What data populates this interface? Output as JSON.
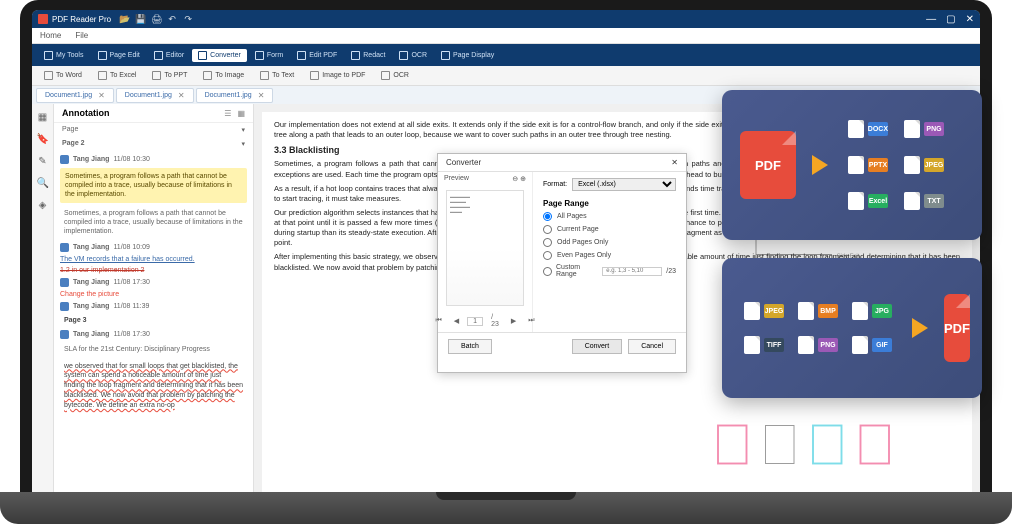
{
  "app": {
    "name": "PDF Reader Pro"
  },
  "menu": {
    "home": "Home",
    "file": "File"
  },
  "ribbon": [
    {
      "label": "My Tools"
    },
    {
      "label": "Page Edit"
    },
    {
      "label": "Editor"
    },
    {
      "label": "Converter",
      "active": true
    },
    {
      "label": "Form"
    },
    {
      "label": "Edit PDF"
    },
    {
      "label": "Redact"
    },
    {
      "label": "OCR"
    },
    {
      "label": "Page Display"
    }
  ],
  "subribbon": [
    {
      "label": "To Word"
    },
    {
      "label": "To Excel"
    },
    {
      "label": "To PPT"
    },
    {
      "label": "To Image"
    },
    {
      "label": "To Text"
    },
    {
      "label": "Image to PDF"
    },
    {
      "label": "OCR"
    }
  ],
  "tabs": [
    {
      "name": "Document1.jpg"
    },
    {
      "name": "Document1.jpg"
    },
    {
      "name": "Document1.jpg"
    }
  ],
  "annotation": {
    "title": "Annotation",
    "filter": "Page",
    "page_label": "Page 2",
    "items": [
      {
        "author": "Tang Jiang",
        "time": "11/08 10:30",
        "type": "highlight",
        "text": "Sometimes, a program follows a path that cannot be compiled into a trace, usually because of limitations in the implementation."
      },
      {
        "type": "note",
        "text": "Sometimes, a program follows a path that cannot be compiled into a trace, usually because of limitations in the implementation."
      },
      {
        "author": "Tang Jiang",
        "time": "11/08 10:09",
        "type": "link",
        "text": "The VM records that a failure has occurred."
      },
      {
        "type": "strike",
        "text": "1.2 in our implementation 2"
      },
      {
        "author": "Tang Jiang",
        "time": "11/08 17:30",
        "type": "red",
        "text": "Change the picture"
      },
      {
        "author": "Tang Jiang",
        "time": "11/08 11:39",
        "type": "page",
        "text": "Page 3"
      },
      {
        "author": "Tang Jiang",
        "time": "11/08 17:30",
        "type": "plain",
        "text": "SLA for the 21st Century: Disciplinary Progress"
      },
      {
        "type": "underline",
        "text": "we observed that for small loops that get blacklisted, the system can spend a noticeable amount of time just finding the loop fragment and determining that it has been blacklisted. We now avoid that problem by patching the bytecode. We define an extra no-op"
      }
    ]
  },
  "document": {
    "para1": "Our implementation does not extend at all side exits. It extends only if the side exit is for a control-flow branch, and only if the side exit does not leave the loop. In particular we do not want to extend a trace tree along a path that leads to an outer loop, because we want to cover such paths in an outer tree through tree nesting.",
    "heading": "3.3   Blacklisting",
    "para2": "Sometimes, a program follows a path that cannot be compiled into a trace, usually because of limitations. Tracing such paths and catching of arbitrary exceptions must be handled carefully because exceptions are used. Each time the program opts to use exception handling, our system must incur a punishing runtime overhead to build a trace for this path and discard it, tracing every time we overflow.",
    "para3": "As a result, if a hot loop contains traces that always fail, it could potentially run much slower because the VM repeatedly spends time tracing but is never able to run any. To avoid this, whenever we are about to start tracing, it must take measures.",
    "para4": "Our prediction algorithm selects instances that have been tried and failed. The VM records exits starting at a given point, the first time. After a failure, the VM also sets a counter so that it will not try to record at that point until it is passed a few more times (32 in our implementation). This backoff counter gives temporary loops a chance to prevent tracing a changing execution pattern, which stabilizes differently during startup than its steady-state execution. After a given number of failures (2 in our implementation), the VM marks the fragment as blacklisted, which means the VM will never again start recording at that point.",
    "para5": "After implementing this basic strategy, we observed that for small loops that get blacklisted, the system can spend a noticeable amount of time just finding the loop fragment and determining that it has been blacklisted. We now avoid that problem by patching the bytecode. We define an extra no-op bytecode that indicates a loop"
  },
  "converter": {
    "title": "Converter",
    "preview": "Preview",
    "format_label": "Format:",
    "format_value": "Excel (.xlsx)",
    "page_range": "Page Range",
    "opt_all": "All Pages",
    "opt_current": "Current Page",
    "opt_odd": "Odd Pages Only",
    "opt_even": "Even Pages Only",
    "opt_custom": "Custom Range",
    "custom_placeholder": "e.g. 1,3 - 5,10",
    "total": "/23",
    "current": "1",
    "of": "/ 23",
    "batch": "Batch",
    "convert": "Convert",
    "cancel": "Cancel"
  },
  "cards": {
    "pdf": "PDF",
    "out": [
      "DOCX",
      "PNG",
      "PPTX",
      "JPEG",
      "Excel",
      "TXT"
    ],
    "in": [
      "JPEG",
      "BMP",
      "JPG",
      "TIFF",
      "PNG",
      "GIF"
    ]
  }
}
